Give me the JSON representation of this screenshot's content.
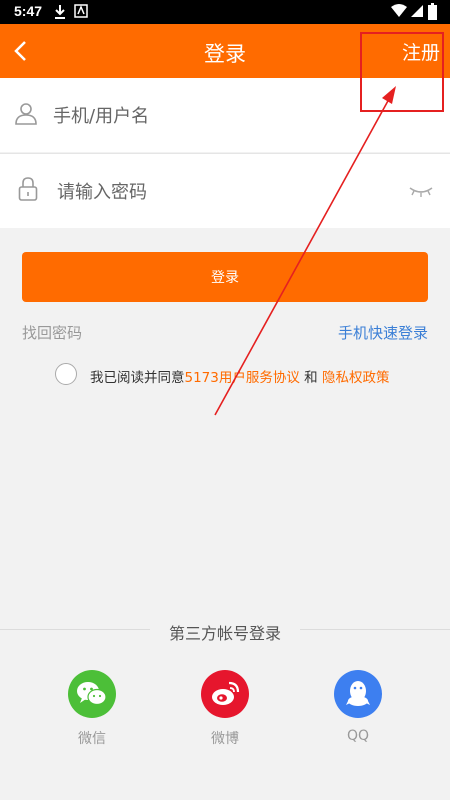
{
  "status_bar": {
    "time": "5:47"
  },
  "header": {
    "title": "登录",
    "register": "注册"
  },
  "form": {
    "username_placeholder": "手机/用户名",
    "password_placeholder": "请输入密码",
    "login_button": "登录",
    "find_password": "找回密码",
    "quick_login": "手机快速登录"
  },
  "agreement": {
    "prefix": "我已阅读并同意",
    "service_link": "5173用户服务协议",
    "and": " 和 ",
    "privacy_link": "隐私权政策",
    "checked": false
  },
  "third_party": {
    "title": "第三方帐号登录",
    "items": [
      {
        "label": "微信",
        "icon": "wechat-icon",
        "color": "#4cbf38"
      },
      {
        "label": "微博",
        "icon": "weibo-icon",
        "color": "#e6162d"
      },
      {
        "label": "QQ",
        "icon": "qq-icon",
        "color": "#3d7ff0"
      }
    ]
  },
  "colors": {
    "accent": "#ff6b00",
    "link_blue": "#3b7fd6",
    "annotation_red": "#e52020"
  }
}
